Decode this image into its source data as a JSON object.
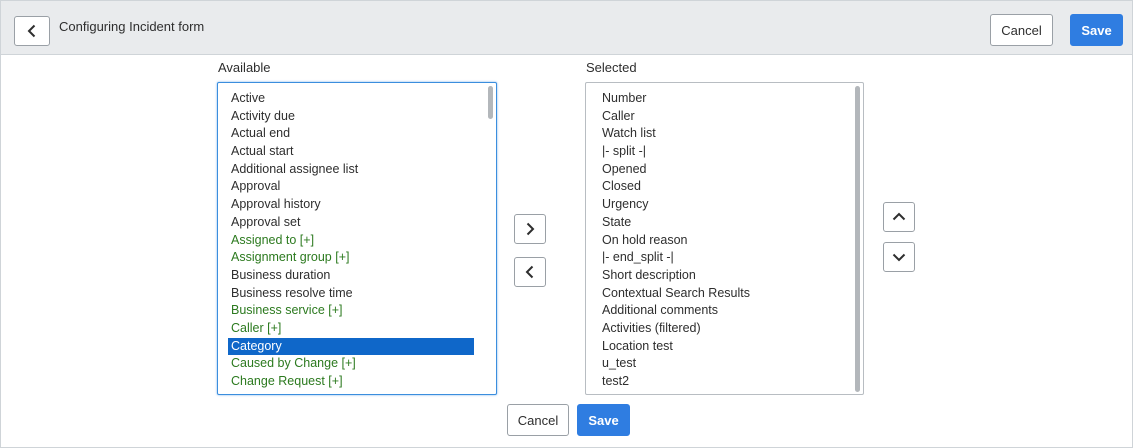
{
  "header": {
    "title": "Configuring Incident form",
    "cancel_label": "Cancel",
    "save_label": "Save"
  },
  "available": {
    "label": "Available",
    "items": [
      {
        "text": "Active",
        "style": "normal"
      },
      {
        "text": "Activity due",
        "style": "normal"
      },
      {
        "text": "Actual end",
        "style": "normal"
      },
      {
        "text": "Actual start",
        "style": "normal"
      },
      {
        "text": "Additional assignee list",
        "style": "normal"
      },
      {
        "text": "Approval",
        "style": "normal"
      },
      {
        "text": "Approval history",
        "style": "normal"
      },
      {
        "text": "Approval set",
        "style": "normal"
      },
      {
        "text": "Assigned to [+]",
        "style": "green"
      },
      {
        "text": "Assignment group [+]",
        "style": "green"
      },
      {
        "text": "Business duration",
        "style": "normal"
      },
      {
        "text": "Business resolve time",
        "style": "normal"
      },
      {
        "text": "Business service [+]",
        "style": "green"
      },
      {
        "text": "Caller [+]",
        "style": "green"
      },
      {
        "text": "Category",
        "style": "selected"
      },
      {
        "text": "Caused by Change [+]",
        "style": "green"
      },
      {
        "text": "Change Request [+]",
        "style": "green"
      }
    ]
  },
  "selected": {
    "label": "Selected",
    "items": [
      "Number",
      "Caller",
      "Watch list",
      "|- split -|",
      "Opened",
      "Closed",
      "Urgency",
      "State",
      "On hold reason",
      "|- end_split -|",
      "Short description",
      "Contextual Search Results",
      "Additional comments",
      "Activities (filtered)",
      "Location test",
      "u_test",
      "test2"
    ]
  },
  "footer": {
    "cancel_label": "Cancel",
    "save_label": "Save"
  },
  "icons": {
    "back": "chevron-left-icon",
    "add": "chevron-right-icon",
    "remove": "chevron-left-icon",
    "move_up": "chevron-up-icon",
    "move_down": "chevron-down-icon"
  },
  "colors": {
    "primary": "#2f7de1",
    "selection": "#0f67c9",
    "reference_field": "#2c7a1f",
    "header_bg": "#e9ebed"
  }
}
